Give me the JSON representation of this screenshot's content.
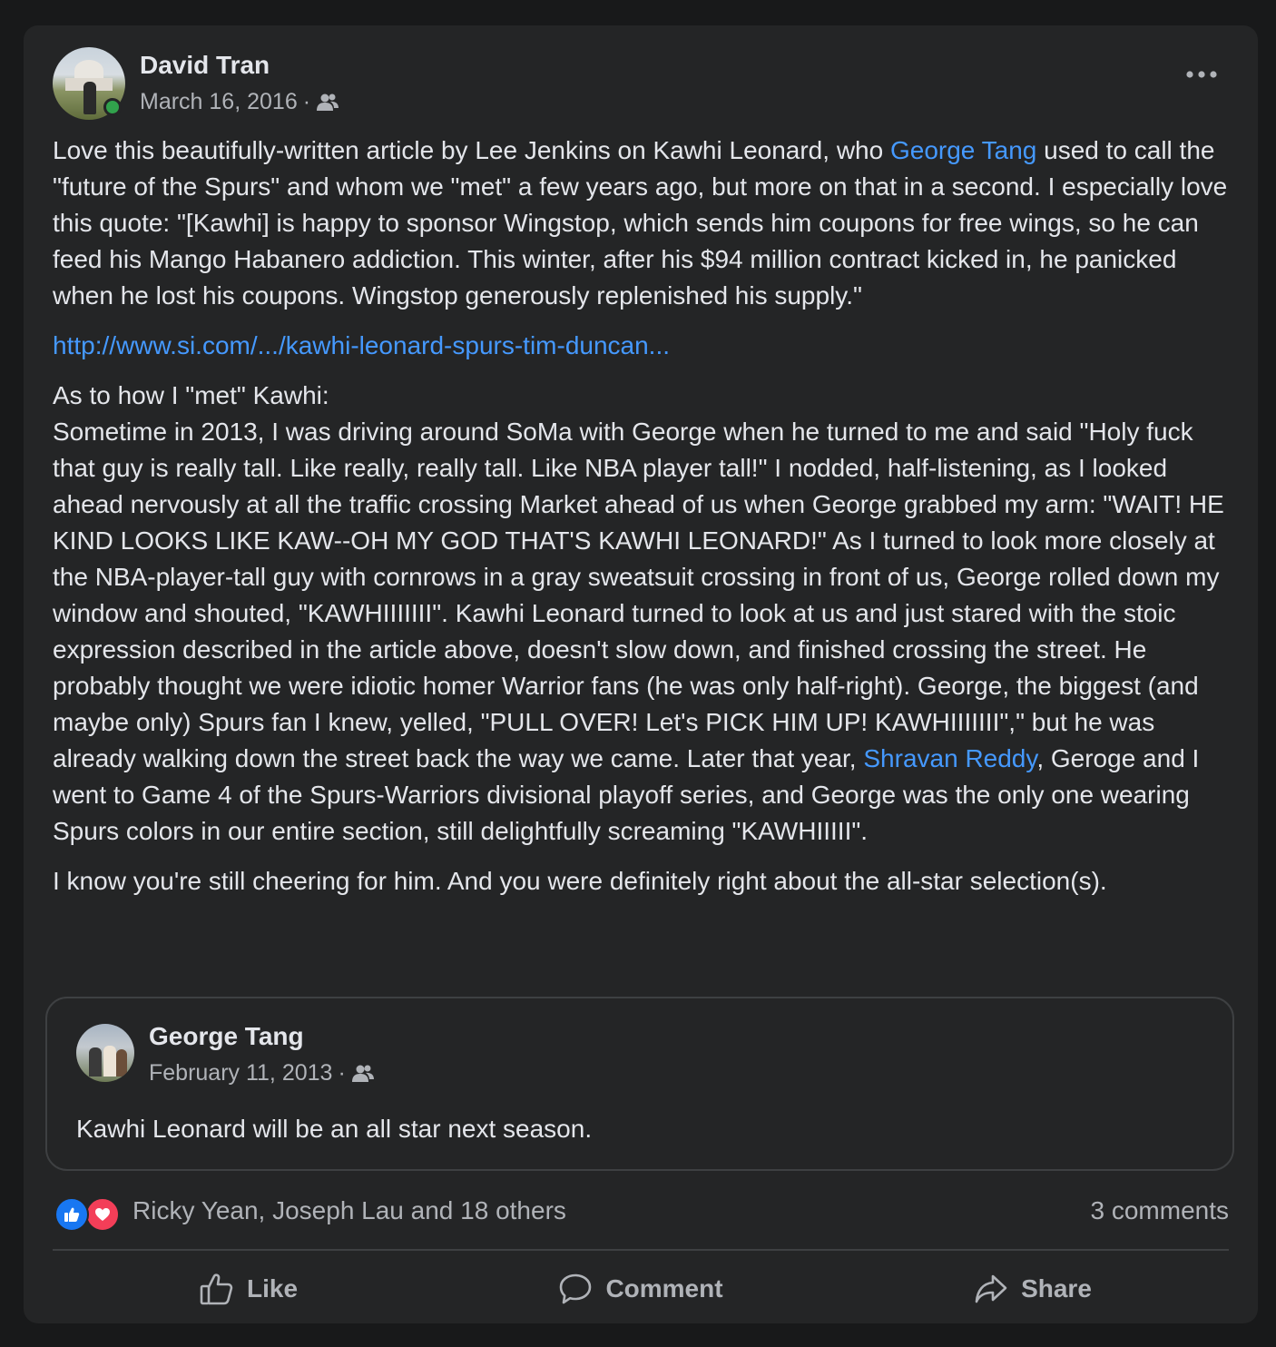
{
  "post": {
    "author": "David Tran",
    "date": "March 16, 2016",
    "separator": "·",
    "audience_icon": "friends-icon",
    "paragraphs": [
      [
        {
          "text": "Love this beautifully-written article by Lee Jenkins on Kawhi Leonard, who ",
          "link": false
        },
        {
          "text": "George Tang",
          "link": true
        },
        {
          "text": " used to call the \"future of the Spurs\" and whom we \"met\" a few years ago, but more on that in a second. I especially love this quote: \"[Kawhi] is happy to sponsor Wingstop, which sends him coupons for free wings, so he can feed his Mango Habanero addiction. This winter, after his $94 million contract kicked in, he panicked when he lost his coupons. Wingstop generously replenished his supply.\"",
          "link": false
        }
      ],
      [
        {
          "text": "http://www.si.com/.../kawhi-leonard-spurs-tim-duncan...",
          "link": true
        }
      ],
      [
        {
          "text": "As to how I \"met\" Kawhi:\nSometime in 2013, I was driving around SoMa with George when he turned to me and said \"Holy fuck that guy is really tall. Like really, really tall. Like NBA player tall!\" I nodded, half-listening, as I looked ahead nervously at all the traffic crossing Market ahead of us when George grabbed my arm: \"WAIT! HE KIND LOOKS LIKE KAW--OH MY GOD THAT'S KAWHI LEONARD!\" As I turned to look more closely at the NBA-player-tall guy with cornrows in a gray sweatsuit crossing in front of us, George rolled down my window and shouted, \"KAWHIIIIIII\". Kawhi Leonard turned to look at us and just stared with the stoic expression described in the article above, doesn't slow down, and finished crossing the street. He probably thought we were idiotic homer Warrior fans (he was only half-right). George, the biggest (and maybe only) Spurs fan I knew, yelled, \"PULL OVER! Let's PICK HIM UP! KAWHIIIIIII\",\" but he was already walking down the street back the way we came. Later that year, ",
          "link": false
        },
        {
          "text": "Shravan Reddy",
          "link": true
        },
        {
          "text": ", Geroge and I went to Game 4 of the Spurs-Warriors divisional playoff series, and George was the only one wearing Spurs colors in our entire section, still delightfully screaming \"KAWHIIIII\".",
          "link": false
        }
      ],
      [
        {
          "text": "I know you're still cheering for him. And you were definitely right about the all-star selection(s).",
          "link": false
        }
      ]
    ]
  },
  "shared_post": {
    "author": "George Tang",
    "date": "February 11, 2013",
    "separator": "·",
    "text": "Kawhi Leonard will be an all star next season."
  },
  "reactions": {
    "icons": [
      "like-reaction-icon",
      "love-reaction-icon"
    ],
    "names": "Ricky Yean, Joseph Lau and 18 others",
    "comments": "3 comments"
  },
  "actions": {
    "like": "Like",
    "comment": "Comment",
    "share": "Share"
  },
  "colors": {
    "background": "#18191a",
    "card": "#242526",
    "link": "#4599ff",
    "secondary_text": "#b0b3b8",
    "online": "#31a24c",
    "like_blue": "#1877f2",
    "love_red": "#f33e58"
  }
}
